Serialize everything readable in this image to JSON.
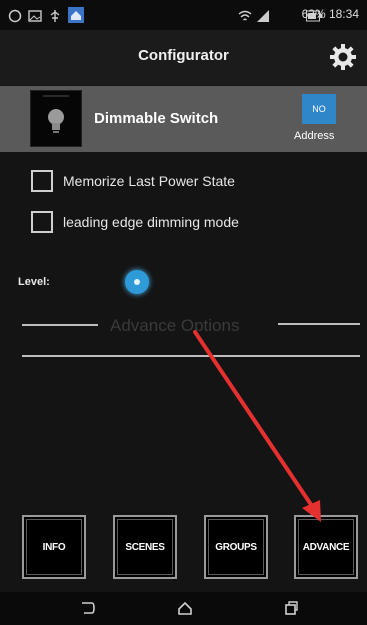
{
  "statusbar": {
    "text": "63% 18:34",
    "icons": [
      "whatsapp-icon",
      "image-icon",
      "usb-icon",
      "home-app-icon",
      "wifi-icon",
      "signal-icon",
      "battery-icon"
    ]
  },
  "titlebar": {
    "title": "Configurator",
    "settings_icon": "gear-icon"
  },
  "device": {
    "name": "Dimmable Switch",
    "address_value": "NO",
    "address_label": "Address"
  },
  "options": [
    {
      "label": "Memorize Last Power State",
      "checked": false
    },
    {
      "label": "leading edge dimming mode",
      "checked": false
    }
  ],
  "level": {
    "label": "Level:"
  },
  "advanced": {
    "title": "Advance Options"
  },
  "bottom_nav": [
    {
      "label": "INFO"
    },
    {
      "label": "SCENES"
    },
    {
      "label": "GROUPS"
    },
    {
      "label": "ADVANCE"
    }
  ],
  "annotation": {
    "arrow_color": "#e53030"
  },
  "system_nav": [
    "back-icon",
    "home-icon",
    "recents-icon"
  ]
}
